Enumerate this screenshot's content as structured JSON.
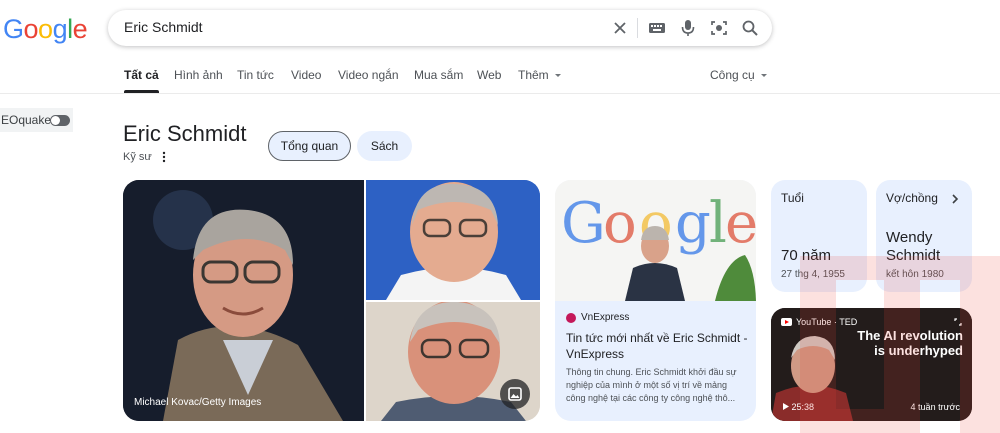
{
  "search": {
    "query": "Eric Schmidt"
  },
  "tabs": [
    {
      "label": "Tất cả",
      "active": true
    },
    {
      "label": "Hình ảnh"
    },
    {
      "label": "Tin tức"
    },
    {
      "label": "Video"
    },
    {
      "label": "Video ngắn"
    },
    {
      "label": "Mua sắm"
    },
    {
      "label": "Web"
    },
    {
      "label": "Thêm"
    }
  ],
  "tools_label": "Công cụ",
  "extension": {
    "label": "EOquake",
    "enabled": false
  },
  "knowledge_panel": {
    "title": "Eric Schmidt",
    "subtitle": "Kỹ sư",
    "chips": [
      "Tổng quan",
      "Sách"
    ]
  },
  "photos": {
    "credit": "Michael Kovac/Getty Images"
  },
  "news_card": {
    "source": "VnExpress",
    "title": "Tin tức mới nhất về Eric Schmidt - VnExpress",
    "snippet": "Thông tin chung. Eric Schmidt khởi đầu sự nghiệp của mình ở một số vị trí về mảng công nghệ tại các công ty công nghệ thô..."
  },
  "facts": [
    {
      "label": "Tuổi",
      "value": "70 năm",
      "sub": "27 thg 4, 1955"
    },
    {
      "label": "Vợ/chồng",
      "value": "Wendy Schmidt",
      "sub": "kết hôn 1980"
    }
  ],
  "video": {
    "source": "YouTube · TED",
    "headline": "The AI revolution is underhyped",
    "duration": "25:38",
    "ago": "4 tuần trước"
  },
  "colors": {
    "accent_chip": "#e8f0fe",
    "logo_blue": "#4285f4",
    "logo_red": "#ea4335",
    "logo_yellow": "#fbbc05",
    "logo_green": "#34a853"
  }
}
